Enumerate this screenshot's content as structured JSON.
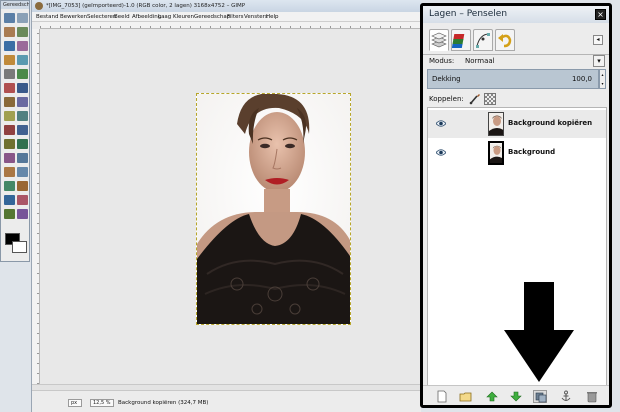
{
  "window": {
    "toolbox_title": "Gereedschap",
    "main_title": "*[IMG_7053] (geïmporteerd)-1.0 (RGB color, 2 lagen) 3168x4752 – GIMP"
  },
  "menubar": [
    "Bestand",
    "Bewerken",
    "Selecteren",
    "Beeld",
    "Afbeelding",
    "Laag",
    "Kleuren",
    "Gereedschap",
    "Filters",
    "Vensters",
    "Help"
  ],
  "statusbar": {
    "unit": "px",
    "zoom": "12,5 %",
    "layer_info": "Background kopiëren (324,7 MB)"
  },
  "dock": {
    "title": "Lagen – Penselen",
    "tabs": [
      "layers-tab",
      "channels-tab",
      "paths-tab",
      "undo-history-tab"
    ],
    "mode_label": "Modus:",
    "mode_value": "Normaal",
    "opacity_label": "Dekking",
    "opacity_value": "100,0",
    "lock_label": "Koppelen:",
    "layers": [
      {
        "name": "Background kopiëren",
        "visible": true,
        "selected": true
      },
      {
        "name": "Background",
        "visible": true,
        "selected": false
      }
    ],
    "bottom_buttons": [
      "new-layer",
      "new-layer-group",
      "raise-layer",
      "lower-layer",
      "duplicate-layer",
      "anchor-layer",
      "delete-layer"
    ]
  },
  "colors": {
    "dock_border": "#000000",
    "opacity_bar": "#b9c6d2",
    "selection_marching_ants": "#b7a62a"
  }
}
